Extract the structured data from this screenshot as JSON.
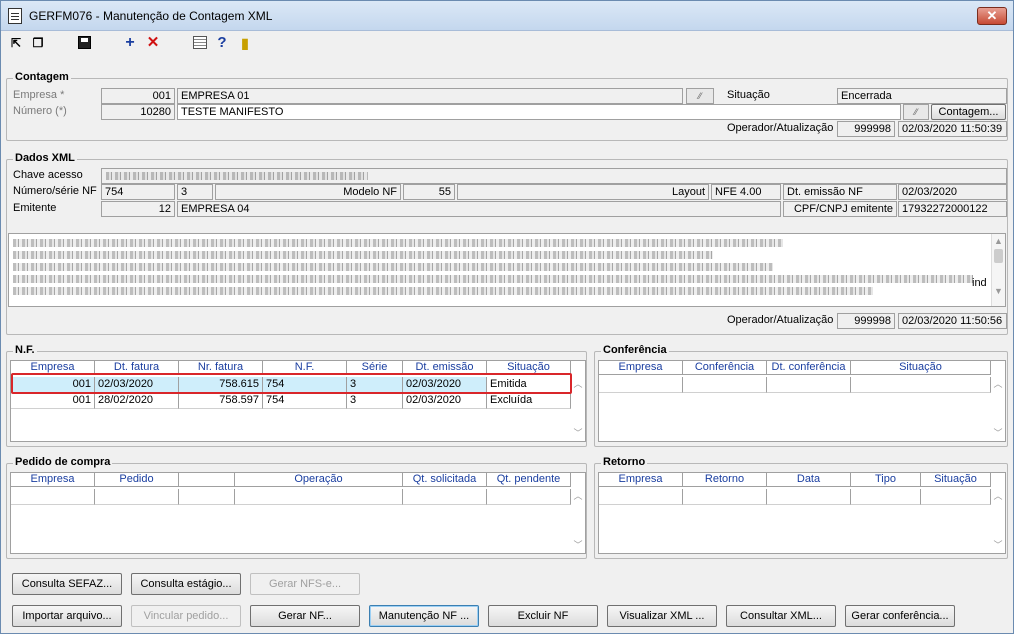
{
  "window": {
    "title": "GERFM076 - Manutenção de Contagem XML",
    "close": "✕"
  },
  "toolbar": [
    "exit-icon",
    "copy-icon",
    "save-icon",
    "add-icon",
    "delete-icon",
    "calendar-icon",
    "help-icon",
    "door-exit-icon"
  ],
  "contagem": {
    "title": "Contagem",
    "empresa_label": "Empresa *",
    "empresa_code": "001",
    "empresa_name": "EMPRESA 01",
    "numero_label": "Número (*)",
    "numero_value": "10280",
    "numero_desc": "TESTE MANIFESTO",
    "situacao_label": "Situação",
    "situacao_value": "Encerrada",
    "contagem_btn": "Contagem...",
    "op_label": "Operador/Atualização",
    "op_value": "999998",
    "op_date": "02/03/2020 11:50:39"
  },
  "dados": {
    "title": "Dados XML",
    "chave_label": "Chave acesso",
    "numero_label": "Número/série NF",
    "numero_value": "754",
    "serie_value": "3",
    "modelo_label": "Modelo NF",
    "modelo_value": "55",
    "layout_label": "Layout",
    "layout_value": "NFE 4.00",
    "dt_label": "Dt. emissão NF",
    "dt_value": "02/03/2020",
    "emitente_label": "Emitente",
    "emitente_code": "12",
    "emitente_name": "EMPRESA 04",
    "cnpj_label": "CPF/CNPJ emitente",
    "cnpj_value": "17932272000122",
    "xml_tail": "ind",
    "op_label": "Operador/Atualização",
    "op_value": "999998",
    "op_date": "02/03/2020 11:50:56"
  },
  "nf": {
    "title": "N.F.",
    "headers": [
      "Empresa",
      "Dt. fatura",
      "Nr. fatura",
      "N.F.",
      "Série",
      "Dt. emissão",
      "Situação"
    ],
    "rows": [
      [
        "001",
        "02/03/2020",
        "758.615",
        "754",
        "3",
        "02/03/2020",
        "Emitida"
      ],
      [
        "001",
        "28/02/2020",
        "758.597",
        "754",
        "3",
        "02/03/2020",
        "Excluída"
      ]
    ]
  },
  "conferencia": {
    "title": "Conferência",
    "headers": [
      "Empresa",
      "Conferência",
      "Dt. conferência",
      "Situação"
    ]
  },
  "pedido": {
    "title": "Pedido de compra",
    "headers": [
      "Empresa",
      "Pedido",
      "",
      "Operação",
      "Qt. solicitada",
      "Qt. pendente"
    ]
  },
  "retorno": {
    "title": "Retorno",
    "headers": [
      "Empresa",
      "Retorno",
      "Data",
      "Tipo",
      "Situação"
    ]
  },
  "buttons": {
    "consulta_sefaz": "Consulta SEFAZ...",
    "consulta_estagio": "Consulta estágio...",
    "gerar_nfse": "Gerar NFS-e...",
    "importar": "Importar arquivo...",
    "vincular": "Vincular pedido...",
    "gerar_nf": "Gerar NF...",
    "manutencao": "Manutenção NF ...",
    "excluir": "Excluir NF",
    "visualizar": "Visualizar XML ...",
    "consultar": "Consultar XML...",
    "gerar_conf": "Gerar conferência..."
  },
  "colors": {
    "highlight": "#cfeefb",
    "annotation_box": "#d9262a",
    "header_text": "#1a3ea0"
  }
}
